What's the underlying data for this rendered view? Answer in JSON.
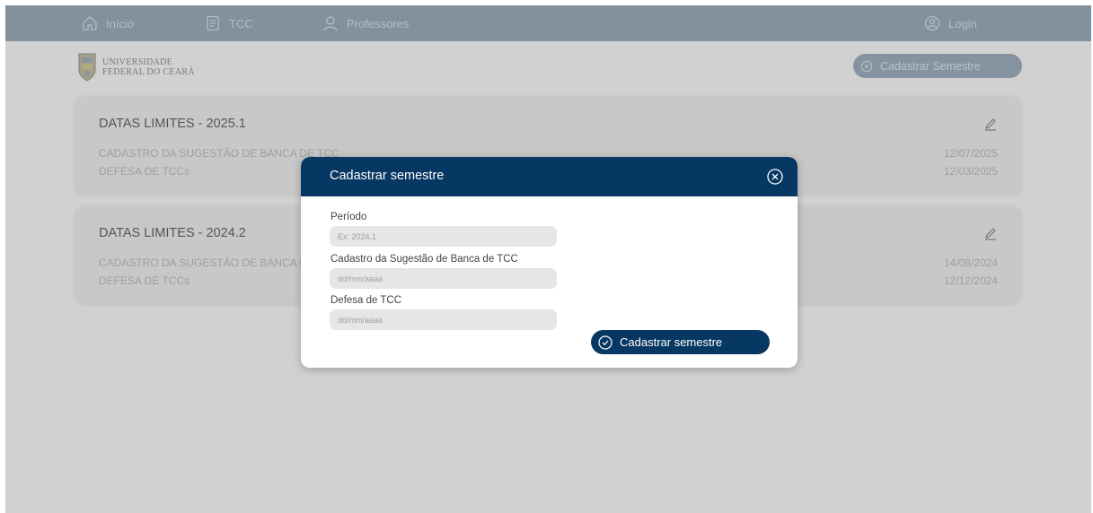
{
  "nav": {
    "home": "Início",
    "tcc": "TCC",
    "professores": "Professores",
    "login": "Login"
  },
  "logo": {
    "line1": "UNIVERSIDADE",
    "line2": "FEDERAL DO CEARÁ"
  },
  "header": {
    "add_semester_label": "Cadastrar Semestre"
  },
  "cards": [
    {
      "title": "DATAS LIMITES - 2025.1",
      "rows": [
        {
          "label": "CADASTRO DA SUGESTÃO DE BANCA DE TCC",
          "date": "12/07/2025"
        },
        {
          "label": "DEFESA DE TCCs",
          "date": "12/03/2025"
        }
      ]
    },
    {
      "title": "DATAS LIMITES - 2024.2",
      "rows": [
        {
          "label": "CADASTRO DA SUGESTÃO DE BANCA DE TCC",
          "date": "14/08/2024"
        },
        {
          "label": "DEFESA DE TCCs",
          "date": "12/12/2024"
        }
      ]
    }
  ],
  "modal": {
    "title": "Cadastrar semestre",
    "fields": [
      {
        "label": "Período",
        "placeholder": "Ex: 2024.1"
      },
      {
        "label": "Cadastro da Sugestão de Banca de TCC",
        "placeholder": "dd/mm/aaaa"
      },
      {
        "label": "Defesa de TCC",
        "placeholder": "dd/mm/aaaa"
      }
    ],
    "submit_label": "Cadastrar semestre"
  },
  "colors": {
    "primary": "#073763",
    "nav_background": "#9eb1c0",
    "input_background": "#e6e6e6"
  }
}
